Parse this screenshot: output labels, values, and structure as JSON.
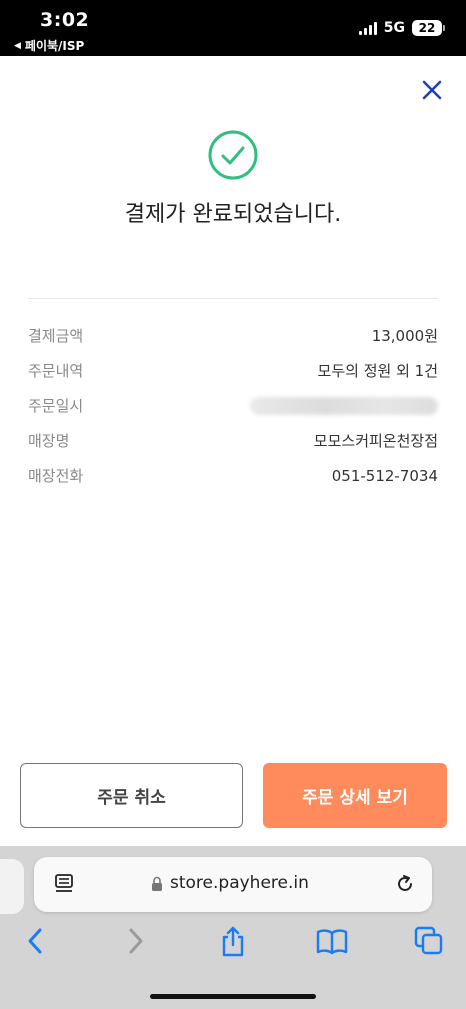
{
  "status_bar": {
    "time": "3:02",
    "back_app": "페이북/ISP",
    "network": "5G",
    "battery": "22"
  },
  "dialog": {
    "title": "결제가 완료되었습니다.",
    "details": [
      {
        "label": "결제금액",
        "value": "13,000원"
      },
      {
        "label": "주문내역",
        "value": "모두의 정원 외 1건"
      },
      {
        "label": "주문일시",
        "value": ""
      },
      {
        "label": "매장명",
        "value": "모모스커피온천장점"
      },
      {
        "label": "매장전화",
        "value": "051-512-7034"
      }
    ],
    "cancel_label": "주문 취소",
    "detail_label": "주문 상세 보기"
  },
  "browser": {
    "url": "store.payhere.in"
  },
  "colors": {
    "accent_orange": "#ff8a5b",
    "success_green": "#2fbf7f",
    "close_blue": "#1f3fbf",
    "ios_blue": "#1a7cf5"
  },
  "icons": [
    "close-icon",
    "check-circle-icon",
    "reader-icon",
    "lock-icon",
    "reload-icon",
    "back-icon",
    "forward-icon",
    "share-icon",
    "bookmarks-icon",
    "tabs-icon"
  ]
}
